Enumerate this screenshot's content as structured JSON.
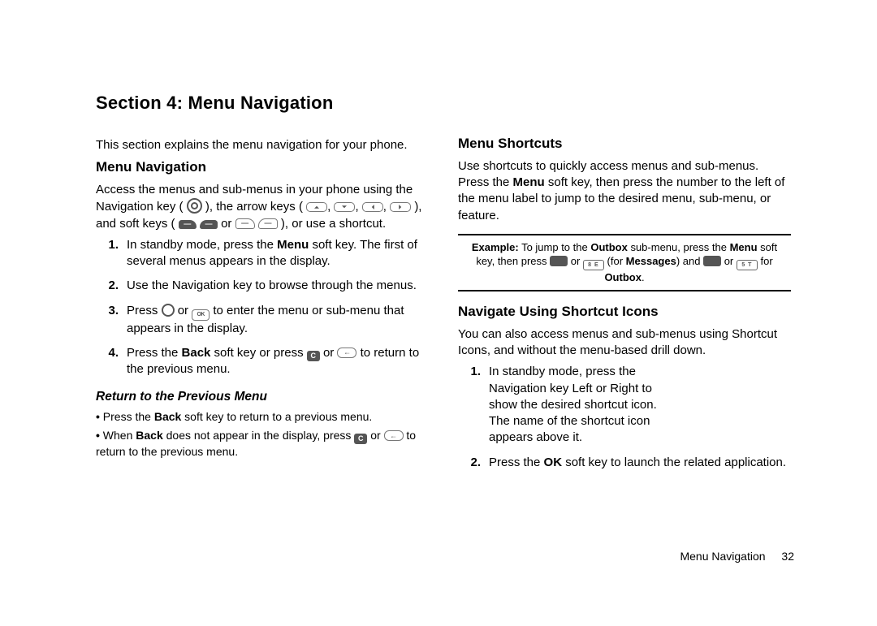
{
  "section_title": "Section 4: Menu Navigation",
  "intro": "This section explains the menu navigation for your phone.",
  "left": {
    "h_menu_nav": "Menu Navigation",
    "access_pre": "Access the menus and sub-menus in your phone using the Navigation key (",
    "access_arrows_pre": "), the arrow keys (",
    "access_arrows_sep": ", ",
    "access_soft_pre": "), and soft keys (",
    "access_or": " or ",
    "access_end": "), or use a shortcut.",
    "step1a": "In standby mode, press the ",
    "step1_bold": "Menu",
    "step1b": " soft key. The first of several menus appears in the display.",
    "step2": "Use the Navigation key to browse through the menus.",
    "step3a": "Press ",
    "step3b": " or ",
    "step3c": " to enter the menu or sub-menu that appears in the display.",
    "step4a": "Press the ",
    "step4_bold": "Back",
    "step4b": " soft key or press ",
    "step4c": " or ",
    "step4d": " to return to the previous menu.",
    "h_return": "Return to the Previous Menu",
    "ret1a": "Press the ",
    "ret1_bold": "Back",
    "ret1b": " soft key to return to a previous menu.",
    "ret2a": "When ",
    "ret2_bold": "Back",
    "ret2b": " does not appear in the display, press ",
    "ret2c": " or ",
    "ret2d": " to return to the previous menu."
  },
  "right": {
    "h_shortcuts": "Menu Shortcuts",
    "short_p1a": "Use shortcuts to quickly access menus and sub-menus. Press the ",
    "short_bold": "Menu",
    "short_p1b": " soft key, then press the number to the left of the menu label to jump to the desired menu, sub-menu, or feature.",
    "ex_label": "Example:",
    "ex_a": " To jump to the ",
    "ex_b1": "Outbox",
    "ex_b": " sub-menu, press the ",
    "ex_b2": "Menu",
    "ex_c": " soft key, then press ",
    "ex_or1": " or ",
    "ex_for1a": " (for ",
    "ex_msgs": "Messages",
    "ex_for1b": ") and ",
    "ex_or2": " or ",
    "ex_for2": " for ",
    "ex_outbox": "Outbox",
    "ex_end": ".",
    "h_icons": "Navigate Using Shortcut Icons",
    "icons_p": "You can also access menus and sub-menus using Shortcut Icons, and without the menu-based drill down.",
    "istep1": "In standby mode, press the Navigation key Left or Right to show the desired shortcut icon. The name of the shortcut icon appears above it.",
    "istep2a": "Press the ",
    "istep2_bold": "OK",
    "istep2b": " soft key to launch the related application."
  },
  "footer": {
    "label": "Menu Navigation",
    "page": "32"
  }
}
